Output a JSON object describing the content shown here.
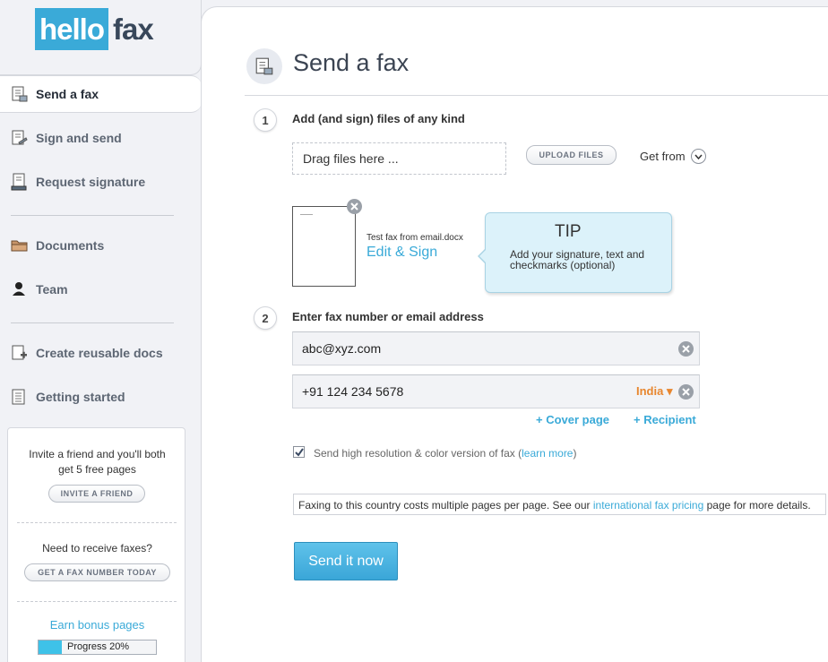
{
  "logo": {
    "part1": "hello",
    "part2": "fax"
  },
  "sidebar": {
    "items": [
      {
        "label": "Send a fax",
        "icon": "fax-doc-icon"
      },
      {
        "label": "Sign and send",
        "icon": "sign-doc-icon"
      },
      {
        "label": "Request signature",
        "icon": "request-signature-icon"
      },
      {
        "label": "Documents",
        "icon": "folder-icon"
      },
      {
        "label": "Team",
        "icon": "person-icon"
      },
      {
        "label": "Create reusable docs",
        "icon": "add-doc-icon"
      },
      {
        "label": "Getting started",
        "icon": "doc-list-icon"
      }
    ],
    "promo": {
      "invite_text": "Invite a friend and you'll both get 5 free pages",
      "invite_button": "INVITE A FRIEND",
      "receive_text": "Need to receive faxes?",
      "fax_number_button": "GET A FAX NUMBER TODAY",
      "earn_link": "Earn bonus pages",
      "progress_label": "Progress 20%",
      "progress_value": 0.2
    }
  },
  "main": {
    "title": "Send a fax",
    "step1": {
      "number": "1",
      "label": "Add (and sign) files of any kind",
      "drop_text": "Drag files here ...",
      "upload_button": "UPLOAD FILES",
      "get_from": "Get from",
      "file_name": "Test fax from email.docx",
      "edit_sign": "Edit & Sign"
    },
    "tip": {
      "title": "TIP",
      "text": "Add your signature, text and checkmarks (optional)"
    },
    "step2": {
      "number": "2",
      "label": "Enter fax number or email address",
      "email_value": "abc@xyz.com",
      "phone_value": "+91 124 234 5678",
      "country": "India ▾",
      "cover_page": "+ Cover page",
      "recipient": "+ Recipient"
    },
    "hires": {
      "checked": true,
      "label": "Send high resolution & color version of fax (",
      "link": "learn more",
      "label_end": ")"
    },
    "notice": {
      "text_before": "Faxing to this country costs multiple pages per page. See our ",
      "link": "international fax pricing",
      "text_after": " page for more details."
    },
    "send_button": "Send it now"
  },
  "colors": {
    "accent": "#3aaad8",
    "country": "#e8862e",
    "logo_dark": "#38475a"
  }
}
